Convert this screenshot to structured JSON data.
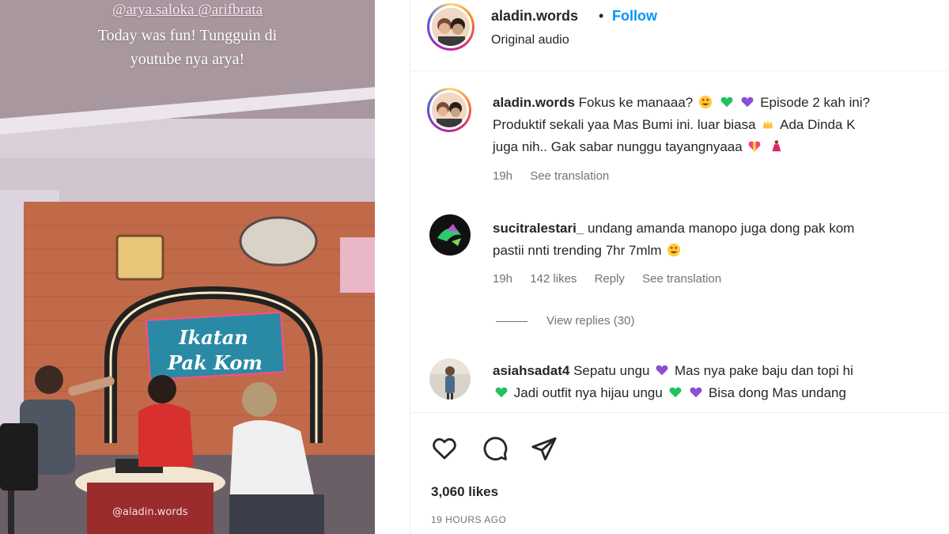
{
  "media": {
    "mentions": "@arya.saloka @arifbrata",
    "caption_line1": "Today was fun! Tungguin di",
    "caption_line2": "youtube nya arya!",
    "set_sign_line1": "Ikatan",
    "set_sign_line2": "Pak Kom",
    "watermark": "@aladin.words"
  },
  "header": {
    "username": "aladin.words",
    "separator": "•",
    "follow_label": "Follow",
    "audio": "Original audio"
  },
  "comments": [
    {
      "username": "aladin.words",
      "line1": "Fokus ke manaaa?",
      "line1b": "Episode 2 kah ini?",
      "line2a": "Produktif sekali yaa Mas Bumi ini. luar biasa",
      "line2b": "Ada Dinda K",
      "line3": "juga nih.. Gak sabar nunggu tayangnyaaa",
      "time": "19h",
      "see_translation": "See translation"
    },
    {
      "username": "sucitralestari_",
      "line1": "undang amanda manopo juga dong pak kom",
      "line2": "pastii nnti trending 7hr 7mlm",
      "time": "19h",
      "likes": "142 likes",
      "reply": "Reply",
      "see_translation": "See translation",
      "view_replies": "View replies (30)"
    },
    {
      "username": "asiahsadat4",
      "line1": "Sepatu ungu",
      "line1b": "Mas nya pake baju dan topi hi",
      "line2a": "Jadi outfit nya hijau ungu",
      "line2b": "Bisa dong Mas undang"
    }
  ],
  "actions": {
    "likes": "3,060 likes",
    "time_ago": "19 HOURS AGO"
  },
  "colors": {
    "link_blue": "#0095f6",
    "secondary_text": "#737373",
    "green_heart": "#1ec45a",
    "purple_heart": "#8a4fd6"
  },
  "icons": [
    "heart-icon",
    "comment-icon",
    "share-icon",
    "heart-eyes-emoji",
    "green-heart-emoji",
    "purple-heart-emoji",
    "raised-hands-emoji"
  ]
}
